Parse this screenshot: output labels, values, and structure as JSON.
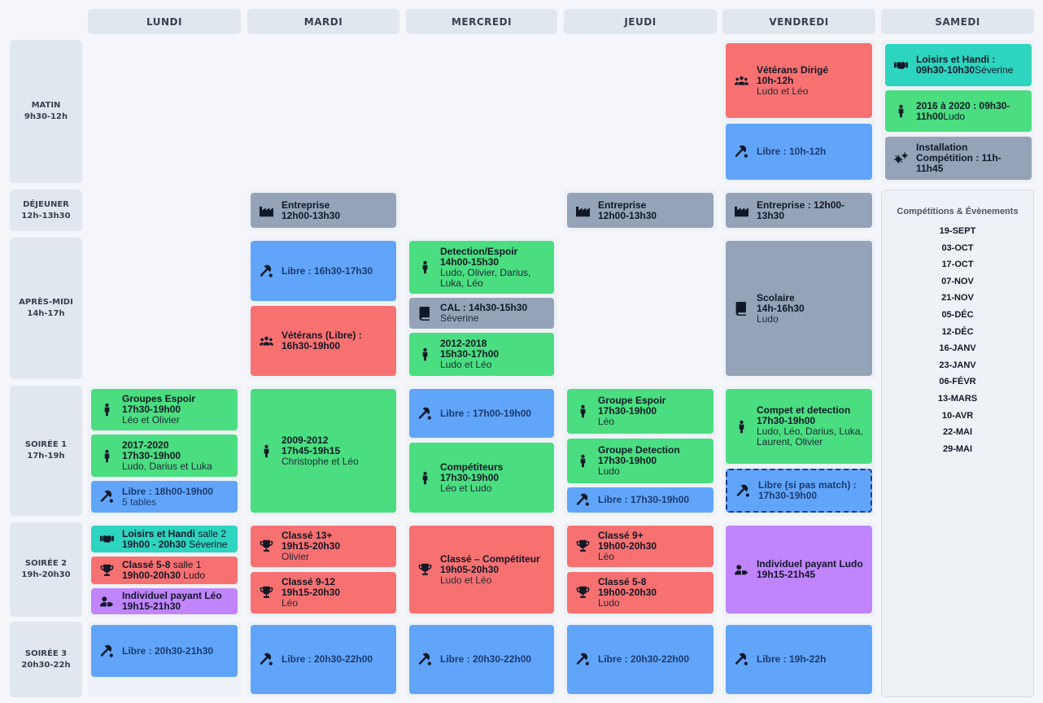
{
  "days": [
    "LUNDI",
    "MARDI",
    "MERCREDI",
    "JEUDI",
    "VENDREDI",
    "SAMEDI"
  ],
  "periods": [
    {
      "name": "MATIN",
      "time": "9h30-12h"
    },
    {
      "name": "DÉJEUNER",
      "time": "12h-13h30"
    },
    {
      "name": "APRÈS-MIDI",
      "time": "14h-17h"
    },
    {
      "name": "SOIRÉE 1",
      "time": "17h-19h"
    },
    {
      "name": "SOIRÉE 2",
      "time": "19h-20h30"
    },
    {
      "name": "SOIRÉE 3",
      "time": "20h30-22h"
    }
  ],
  "colors": {
    "green": "#4ade80",
    "red": "#f87171",
    "blue": "#60a5fa",
    "slate": "#94a3b8",
    "purple": "#c084fc",
    "teal": "#2dd4bf"
  },
  "events": {
    "fri_matin_1": {
      "title": "Vétérans Dirigé",
      "time": "10h-12h",
      "people": "Ludo et Léo",
      "icon": "users-icon"
    },
    "fri_matin_2": {
      "title": "Libre : 10h-12h",
      "icon": "ping-pong-icon"
    },
    "sat_matin_1": {
      "title": "Loisirs et Handi : 09h30-10h30",
      "people": "Séverine",
      "icon": "handshake-icon"
    },
    "sat_matin_2": {
      "title": "2016 à 2020 : 09h30-11h00",
      "people": "Ludo",
      "icon": "child-icon"
    },
    "sat_matin_3": {
      "title": "Installation Compétition : 11h-11h45",
      "icon": "gears-icon"
    },
    "tue_dej": {
      "title": "Entreprise",
      "time": "12h00-13h30",
      "icon": "factory-icon"
    },
    "thu_dej": {
      "title": "Entreprise",
      "time": "12h00-13h30",
      "icon": "factory-icon"
    },
    "fri_dej": {
      "title": "Entreprise : 12h00-13h30",
      "icon": "factory-icon"
    },
    "tue_am_1": {
      "title": "Libre : 16h30-17h30",
      "icon": "ping-pong-icon"
    },
    "tue_am_2": {
      "title": "Vétérans (Libre) :",
      "time": "16h30-19h00",
      "icon": "users-icon"
    },
    "wed_am_1": {
      "title": "Detection/Espoir",
      "time": "14h00-15h30",
      "people": "Ludo, Olivier, Darius, Luka, Léo",
      "icon": "child-icon"
    },
    "wed_am_2": {
      "title": "CAL : 14h30-15h30",
      "people": "Séverine",
      "icon": "book-icon"
    },
    "wed_am_3": {
      "title": "2012-2018",
      "time": "15h30-17h00",
      "people": "Ludo et Léo",
      "icon": "child-icon"
    },
    "fri_am": {
      "title": "Scolaire",
      "time": "14h-16h30",
      "people": "Ludo",
      "icon": "book-icon"
    },
    "mon_s1_1": {
      "title": "Groupes Espoir",
      "time": "17h30-19h00",
      "people": "Léo et Olivier",
      "icon": "child-icon"
    },
    "mon_s1_2": {
      "title": "2017-2020",
      "time": "17h30-19h00",
      "people": "Ludo, Darius et Luka",
      "icon": "child-icon"
    },
    "mon_s1_3": {
      "title": "Libre : 18h00-19h00",
      "people": "5 tables",
      "icon": "ping-pong-icon"
    },
    "tue_s1": {
      "title": "2009-2012",
      "time": "17h45-19h15",
      "people": "Christophe et Léo",
      "icon": "child-icon"
    },
    "wed_s1_1": {
      "title": "Libre : 17h00-19h00",
      "icon": "ping-pong-icon"
    },
    "wed_s1_2": {
      "title": "Compétiteurs",
      "time": "17h30-19h00",
      "people": "Léo et Ludo",
      "icon": "child-icon"
    },
    "thu_s1_1": {
      "title": "Groupe Espoir",
      "time": "17h30-19h00",
      "people": "Léo",
      "icon": "child-icon"
    },
    "thu_s1_2": {
      "title": "Groupe Detection",
      "time": "17h30-19h00",
      "people": "Ludo",
      "icon": "child-icon"
    },
    "thu_s1_3": {
      "title": "Libre : 17h30-19h00",
      "icon": "ping-pong-icon"
    },
    "fri_s1_1": {
      "title": "Compet et detection",
      "time": "17h30-19h00",
      "people": "Ludo, Léo, Darius, Luka, Laurent, Olivier",
      "icon": "child-icon"
    },
    "fri_s1_2": {
      "title": "Libre (si pas match) :",
      "time": "17h30-19h00",
      "icon": "ping-pong-icon"
    },
    "mon_s2_1": {
      "title": "Loisirs et Handi",
      "note": "salle 2",
      "time": "19h00 - 20h30",
      "people": "Séverine",
      "icon": "handshake-icon"
    },
    "mon_s2_2": {
      "title": "Classé 5-8",
      "note": "salle 1",
      "time": "19h00-20h30",
      "people": "Ludo",
      "icon": "trophy-icon"
    },
    "mon_s2_3": {
      "title": "Individuel payant Léo",
      "time": "19h15-21h30",
      "icon": "user-tag-icon"
    },
    "tue_s2_1": {
      "title": "Classé 13+",
      "time": "19h15-20h30",
      "people": "Olivier",
      "icon": "trophy-icon"
    },
    "tue_s2_2": {
      "title": "Classé 9-12",
      "time": "19h15-20h30",
      "people": "Léo",
      "icon": "trophy-icon"
    },
    "wed_s2": {
      "title": "Classé – Compétiteur",
      "time": "19h05-20h30",
      "people": "Ludo et Léo",
      "icon": "trophy-icon"
    },
    "thu_s2_1": {
      "title": "Classé 9+",
      "time": "19h00-20h30",
      "people": "Léo",
      "icon": "trophy-icon"
    },
    "thu_s2_2": {
      "title": "Classé 5-8",
      "time": "19h00-20h30",
      "people": "Ludo",
      "icon": "trophy-icon"
    },
    "fri_s2": {
      "title": "Individuel payant Ludo",
      "time": "19h15-21h45",
      "icon": "user-tag-icon"
    },
    "mon_s3": {
      "title": "Libre : 20h30-21h30",
      "icon": "ping-pong-icon"
    },
    "tue_s3": {
      "title": "Libre : 20h30-22h00",
      "icon": "ping-pong-icon"
    },
    "wed_s3": {
      "title": "Libre : 20h30-22h00",
      "icon": "ping-pong-icon"
    },
    "thu_s3": {
      "title": "Libre : 20h30-22h00",
      "icon": "ping-pong-icon"
    },
    "fri_s3": {
      "title": "Libre : 19h-22h",
      "icon": "ping-pong-icon"
    }
  },
  "competitions": {
    "title": "Compétitions & Évènements",
    "dates": [
      "19-SEPT",
      "03-OCT",
      "17-OCT",
      "07-NOV",
      "21-NOV",
      "05-DÉC",
      "12-DÉC",
      "16-JANV",
      "23-JANV",
      "06-FÉVR",
      "13-MARS",
      "10-AVR",
      "22-MAI",
      "29-MAI"
    ]
  }
}
